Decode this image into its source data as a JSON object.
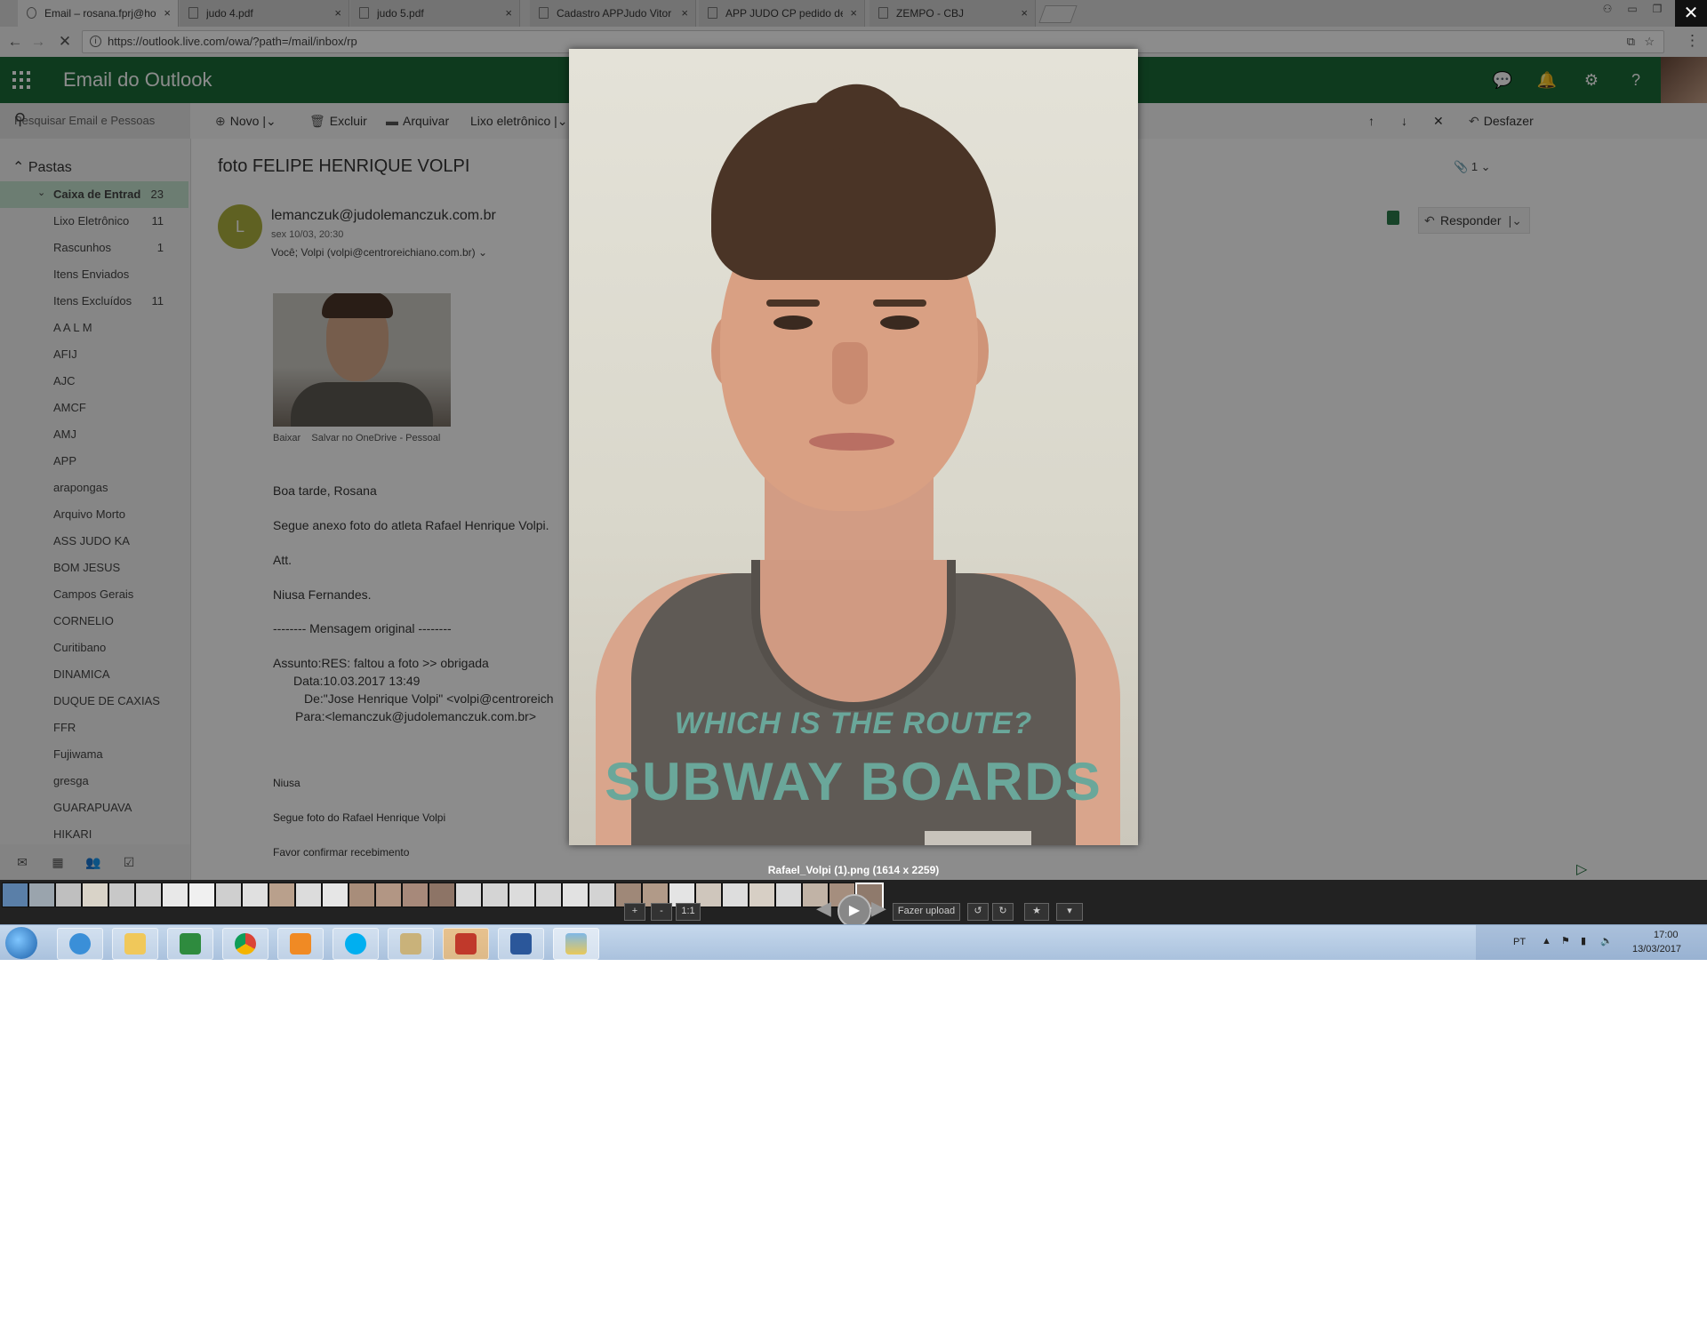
{
  "browser": {
    "tabs": [
      {
        "label": "Email – rosana.fprj@hotr",
        "active": true
      },
      {
        "label": "judo 4.pdf",
        "active": false
      },
      {
        "label": "judo 5.pdf",
        "active": false
      },
      {
        "label": "Cadastro APPJudo Vitor",
        "active": false
      },
      {
        "label": "APP JUDO CP pedido de",
        "active": false
      },
      {
        "label": "ZEMPO - CBJ",
        "active": false
      }
    ],
    "tab_close": "×",
    "url": "https://outlook.live.com/owa/?path=/mail/inbox/rp"
  },
  "outlook": {
    "app_title": "Email do Outlook",
    "search_placeholder": "Pesquisar Email e Pessoas",
    "toolbar": {
      "new": "Novo",
      "delete": "Excluir",
      "archive": "Arquivar",
      "junk": "Lixo eletrônico",
      "undo": "Desfazer"
    },
    "folders_header": "Pastas",
    "folders": [
      {
        "label": "Caixa de Entrad",
        "count": "23",
        "selected": true
      },
      {
        "label": "Lixo Eletrônico",
        "count": "11"
      },
      {
        "label": "Rascunhos",
        "count": "1"
      },
      {
        "label": "Itens Enviados",
        "count": ""
      },
      {
        "label": "Itens Excluídos",
        "count": "11"
      },
      {
        "label": "A A L M",
        "count": ""
      },
      {
        "label": "AFIJ",
        "count": ""
      },
      {
        "label": "AJC",
        "count": ""
      },
      {
        "label": "AMCF",
        "count": ""
      },
      {
        "label": "AMJ",
        "count": ""
      },
      {
        "label": "APP",
        "count": ""
      },
      {
        "label": "arapongas",
        "count": ""
      },
      {
        "label": "Arquivo Morto",
        "count": ""
      },
      {
        "label": "ASS JUDO KA",
        "count": ""
      },
      {
        "label": "BOM JESUS",
        "count": ""
      },
      {
        "label": "Campos Gerais",
        "count": ""
      },
      {
        "label": "CORNELIO",
        "count": ""
      },
      {
        "label": "Curitibano",
        "count": ""
      },
      {
        "label": "DINAMICA",
        "count": ""
      },
      {
        "label": "DUQUE DE CAXIAS",
        "count": ""
      },
      {
        "label": "FFR",
        "count": ""
      },
      {
        "label": "Fujiwama",
        "count": ""
      },
      {
        "label": "gresga",
        "count": ""
      },
      {
        "label": "GUARAPUAVA",
        "count": ""
      },
      {
        "label": "HIKARI",
        "count": ""
      }
    ]
  },
  "message": {
    "subject": "foto FELIPE HENRIQUE VOLPI",
    "attachment_count": "1",
    "sender_initial": "L",
    "sender": "lemanczuk@judolemanczuk.com.br",
    "date": "sex 10/03, 20:30",
    "recipients": "Você; Volpi (volpi@centroreichiano.com.br)",
    "reply_label": "Responder",
    "attachment_actions": {
      "download": "Baixar",
      "save_onedrive": "Salvar no OneDrive - Pessoal"
    },
    "body": [
      "Boa tarde, Rosana",
      "Segue anexo foto do atleta Rafael Henrique Volpi.",
      "Att.",
      "Niusa Fernandes.",
      "-------- Mensagem original --------",
      "Assunto:RES: faltou a foto >> obrigada",
      "Data:10.03.2017 13:49",
      "De:\"Jose Henrique Volpi\" <volpi@centroreich",
      "Para:<lemanczuk@judolemanczuk.com.br>"
    ],
    "quoted": [
      "Niusa",
      "Segue foto do Rafael Henrique Volpi",
      "Favor confirmar recebimento"
    ]
  },
  "viewer": {
    "close": "✕",
    "caption": "Rafael_Volpi (1).png (1614 x 2259)",
    "shirt_text_1": "WHICH IS THE ROUTE?",
    "shirt_text_2": "SUBWAY BOARDS",
    "controls": {
      "zoom_in": "+",
      "zoom_out": "-",
      "actual": "1:1",
      "upload": "Fazer upload"
    }
  },
  "taskbar": {
    "language": "PT",
    "time": "17:00",
    "date": "13/03/2017"
  },
  "colors": {
    "outlook_green": "#1a6b37",
    "selected_folder": "#c5e4cf",
    "sender_avatar": "#aeb13e"
  }
}
